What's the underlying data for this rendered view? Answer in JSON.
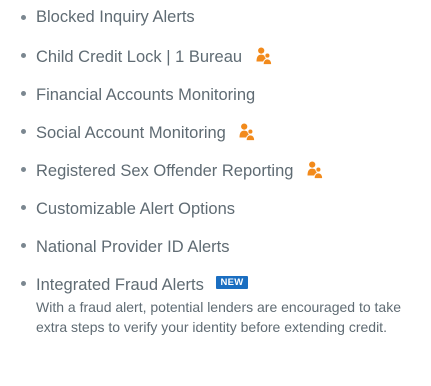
{
  "features": [
    {
      "label": "Blocked Inquiry Alerts",
      "family_icon": false
    },
    {
      "label": "Child Credit Lock | 1 Bureau",
      "family_icon": true
    },
    {
      "label": "Financial Accounts Monitoring",
      "family_icon": false
    },
    {
      "label": "Social Account Monitoring",
      "family_icon": true
    },
    {
      "label": "Registered Sex Offender Reporting",
      "family_icon": true
    },
    {
      "label": "Customizable Alert Options",
      "family_icon": false
    },
    {
      "label": "National Provider ID Alerts",
      "family_icon": false
    },
    {
      "label": "Integrated Fraud Alerts",
      "badge": "NEW",
      "description": "With a fraud alert, potential lenders are encouraged to take extra steps to verify your identity before extending credit."
    }
  ],
  "colors": {
    "text": "#5f6b73",
    "bullet": "#7b8790",
    "family_icon": "#f28a1b",
    "badge_bg": "#1a6ec1",
    "badge_text": "#ffffff"
  },
  "icons": {
    "family": "family-icon"
  }
}
